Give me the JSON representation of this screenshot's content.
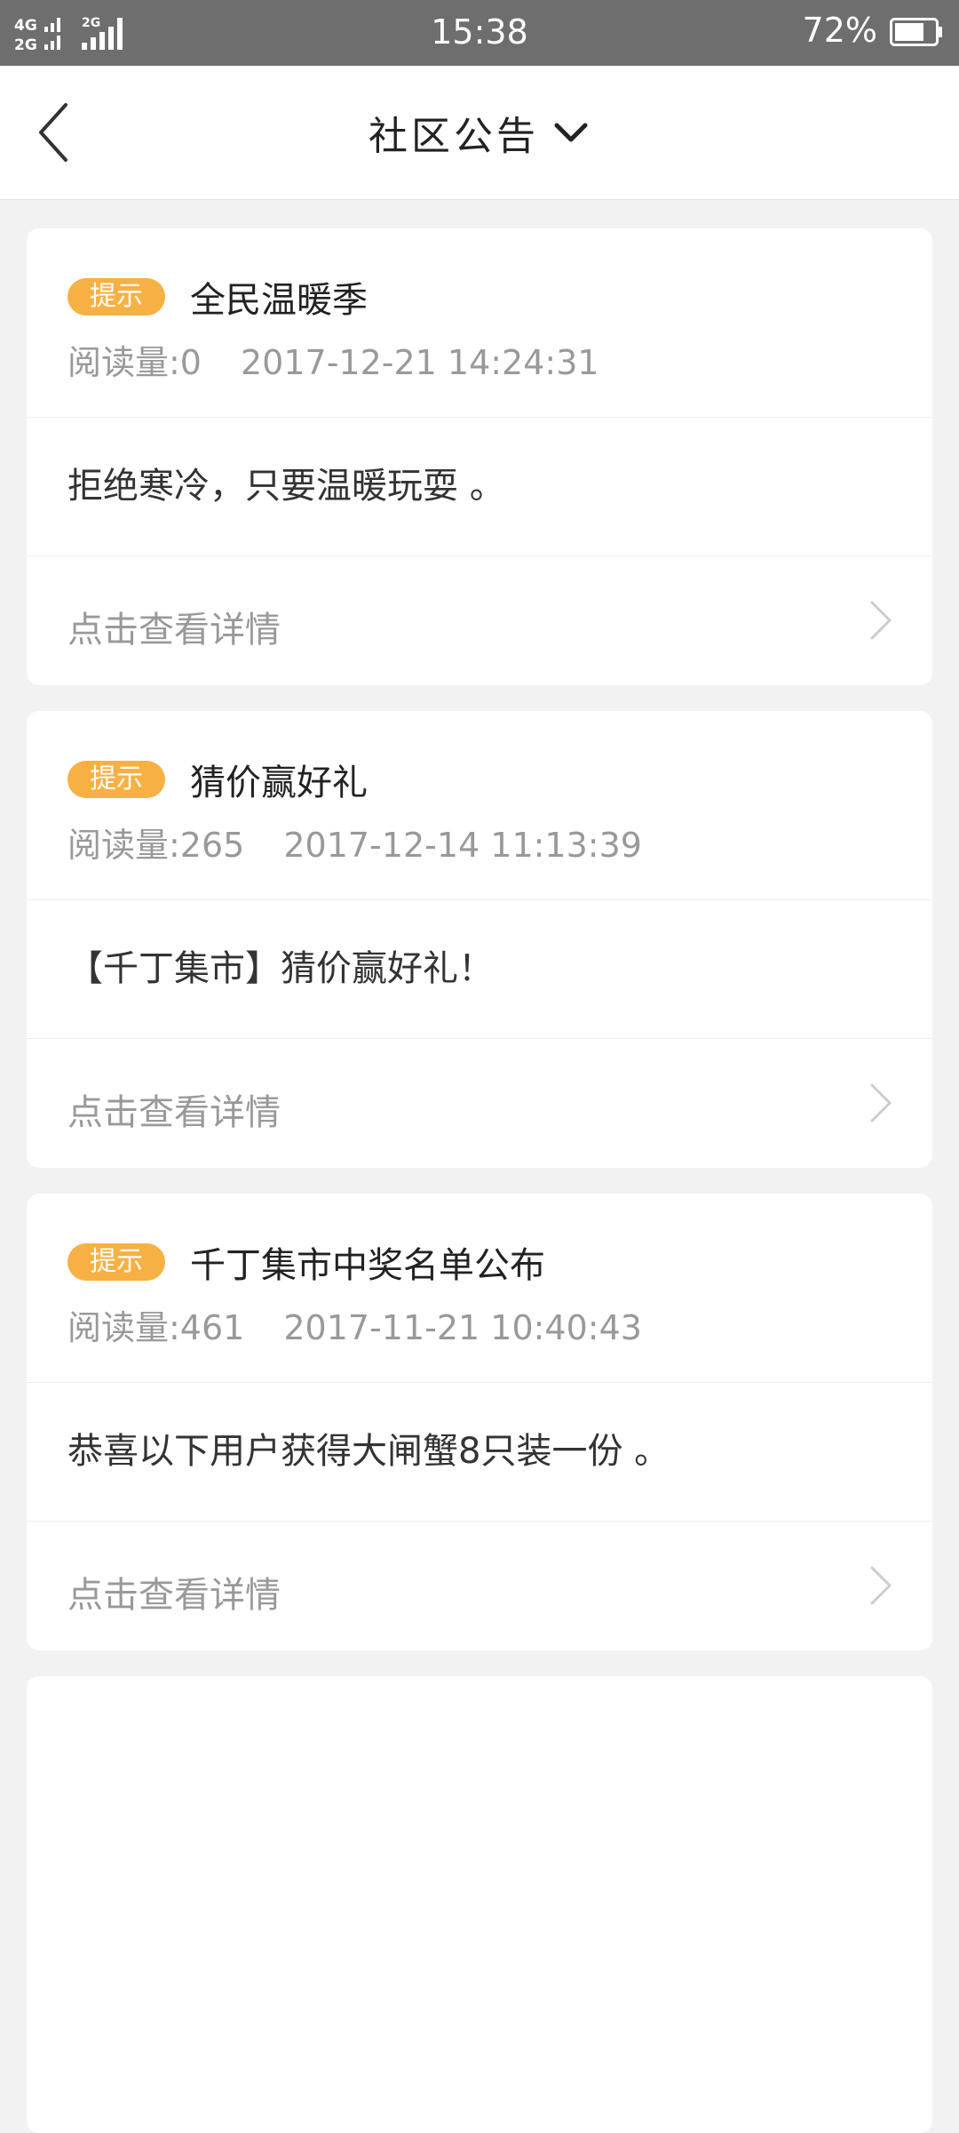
{
  "status_bar": {
    "network_top": "4G",
    "network_bottom": "2G",
    "network_second": "2G",
    "time": "15:38",
    "battery_percent": "72%",
    "battery_level": 0.72
  },
  "header": {
    "title": "社区公告",
    "back_icon": "chevron-left-icon",
    "dropdown_icon": "chevron-down-icon"
  },
  "colors": {
    "tag_background": "#f7b043",
    "status_bar": "#6e6e6e",
    "page_background": "#f2f2f2"
  },
  "announcements": [
    {
      "tag": "提示",
      "title": "全民温暖季",
      "read_label": "阅读量:0",
      "date": "2017-12-21 14:24:31",
      "content": "拒绝寒冷，只要温暖玩耍 。",
      "detail_label": "点击查看详情"
    },
    {
      "tag": "提示",
      "title": "猜价赢好礼",
      "read_label": "阅读量:265",
      "date": "2017-12-14 11:13:39",
      "content": "【千丁集市】猜价赢好礼！",
      "detail_label": "点击查看详情"
    },
    {
      "tag": "提示",
      "title": "千丁集市中奖名单公布",
      "read_label": "阅读量:461",
      "date": "2017-11-21 10:40:43",
      "content": "恭喜以下用户获得大闸蟹8只装一份 。",
      "detail_label": "点击查看详情"
    }
  ]
}
